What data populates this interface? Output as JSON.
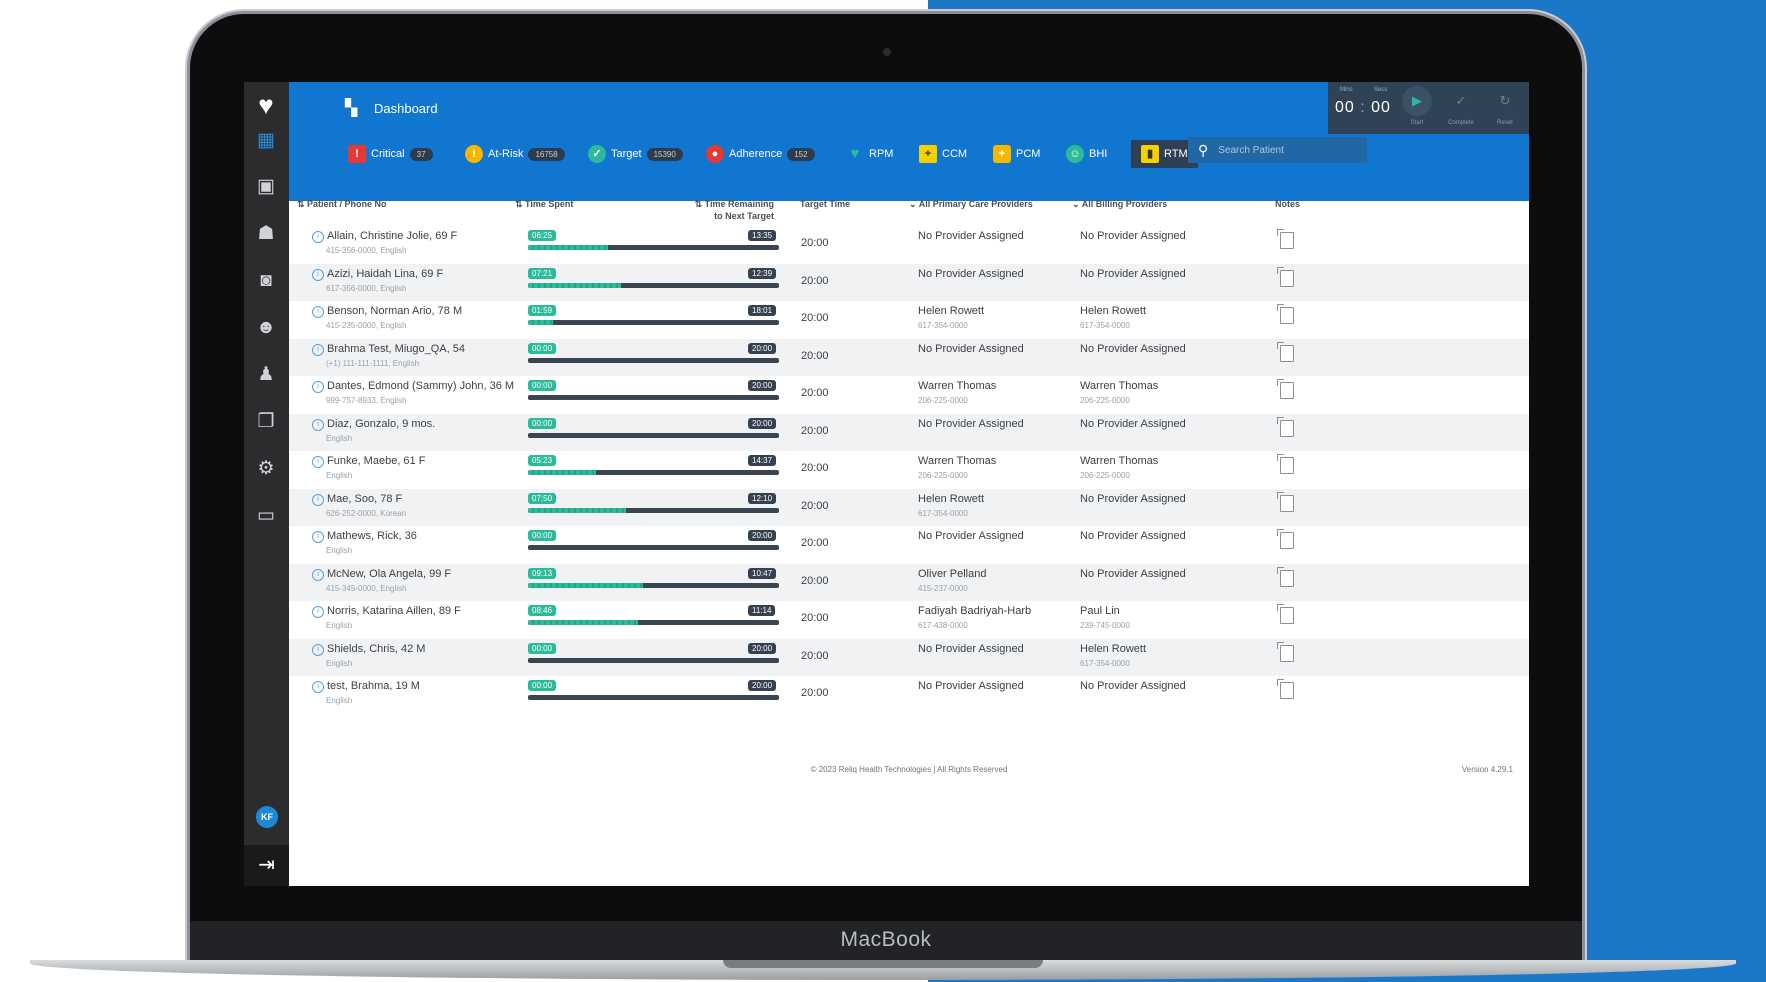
{
  "device": {
    "brand_label": "MacBook"
  },
  "app": {
    "title": "Dashboard",
    "search_placeholder": "Search Patient",
    "footer_text": "© 2023 Reliq Health Technologies | All Rights Reserved",
    "version": "Version 4.29.1"
  },
  "timer": {
    "mins_label": "Mins",
    "secs_label": "Secs",
    "minutes": "00",
    "separator": ":",
    "seconds": "00",
    "start_label": "Start",
    "complete_label": "Complete",
    "reset_label": "Reset"
  },
  "filters": [
    {
      "label": "Critical",
      "count": "37",
      "icon": "warning-triangle-icon",
      "color": "#e53935"
    },
    {
      "label": "At-Risk",
      "count": "16758",
      "icon": "exclamation-icon",
      "color": "#f5b800"
    },
    {
      "label": "Target",
      "count": "15390",
      "icon": "check-circle-icon",
      "color": "#2bbb9a"
    },
    {
      "label": "Adherence",
      "count": "152",
      "icon": "adherence-icon",
      "color": "#e53935"
    },
    {
      "label": "RPM",
      "icon": "heart-icon",
      "color": "#2bbb9a"
    },
    {
      "label": "CCM",
      "icon": "clipboard-plus-icon",
      "color": "#f5d100"
    },
    {
      "label": "PCM",
      "icon": "briefcase-icon",
      "color": "#f5b800"
    },
    {
      "label": "BHI",
      "icon": "head-icon",
      "color": "#2bbb9a"
    },
    {
      "label": "RTM",
      "icon": "rtm-icon",
      "color": "#f5d100"
    }
  ],
  "table": {
    "headers": {
      "patient": "Patient / Phone No",
      "time_spent": "Time Spent",
      "time_remaining_1": "Time Remaining",
      "time_remaining_2": "to Next Target",
      "target_time": "Target Time",
      "pcp": "All Primary Care Providers",
      "billing": "All Billing Providers",
      "notes": "Notes"
    },
    "rows": [
      {
        "name": "Allain, Christine Jolie, 69 F",
        "sub": "415-356-0000, English",
        "spent": "06:25",
        "remaining": "13:35",
        "progress": 0.32,
        "target": "20:00",
        "pcp": "No Provider Assigned",
        "pcp_phone": "",
        "billing": "No Provider Assigned",
        "billing_phone": ""
      },
      {
        "name": "Azizi, Haidah Lina, 69 F",
        "sub": "617-356-0000, English",
        "spent": "07:21",
        "remaining": "12:39",
        "progress": 0.37,
        "target": "20:00",
        "pcp": "No Provider Assigned",
        "pcp_phone": "",
        "billing": "No Provider Assigned",
        "billing_phone": ""
      },
      {
        "name": "Benson, Norman Ario, 78 M",
        "sub": "415-235-0000, English",
        "spent": "01:59",
        "remaining": "18:01",
        "progress": 0.1,
        "target": "20:00",
        "pcp": "Helen Rowett",
        "pcp_phone": "617-354-0000",
        "billing": "Helen Rowett",
        "billing_phone": "617-354-0000"
      },
      {
        "name": "Brahma Test, Miugo_QA, 54",
        "sub": "(+1) 111-111-1111, English",
        "spent": "00:00",
        "remaining": "20:00",
        "progress": 0,
        "target": "20:00",
        "pcp": "No Provider Assigned",
        "pcp_phone": "",
        "billing": "No Provider Assigned",
        "billing_phone": ""
      },
      {
        "name": "Dantes, Edmond (Sammy) John, 36 M",
        "sub": "999-757-8933, English",
        "spent": "00:00",
        "remaining": "20:00",
        "progress": 0,
        "target": "20:00",
        "pcp": "Warren Thomas",
        "pcp_phone": "206-225-0000",
        "billing": "Warren Thomas",
        "billing_phone": "206-225-0000"
      },
      {
        "name": "Diaz, Gonzalo, 9 mos.",
        "sub": "English",
        "spent": "00:00",
        "remaining": "20:00",
        "progress": 0,
        "target": "20:00",
        "pcp": "No Provider Assigned",
        "pcp_phone": "",
        "billing": "No Provider Assigned",
        "billing_phone": ""
      },
      {
        "name": "Funke, Maebe, 61 F",
        "sub": "English",
        "spent": "05:23",
        "remaining": "14:37",
        "progress": 0.27,
        "target": "20:00",
        "pcp": "Warren Thomas",
        "pcp_phone": "206-225-0000",
        "billing": "Warren Thomas",
        "billing_phone": "206-225-0000"
      },
      {
        "name": "Mae, Soo, 78 F",
        "sub": "626-252-0000, Korean",
        "spent": "07:50",
        "remaining": "12:10",
        "progress": 0.39,
        "target": "20:00",
        "pcp": "Helen Rowett",
        "pcp_phone": "617-354-0000",
        "billing": "No Provider Assigned",
        "billing_phone": ""
      },
      {
        "name": "Mathews, Rick, 36",
        "sub": "English",
        "spent": "00:00",
        "remaining": "20:00",
        "progress": 0,
        "target": "20:00",
        "pcp": "No Provider Assigned",
        "pcp_phone": "",
        "billing": "No Provider Assigned",
        "billing_phone": ""
      },
      {
        "name": "McNew, Ola Angela, 99 F",
        "sub": "415-345-0000, English",
        "spent": "09:13",
        "remaining": "10:47",
        "progress": 0.46,
        "target": "20:00",
        "pcp": "Oliver Pelland",
        "pcp_phone": "415-237-0000",
        "billing": "No Provider Assigned",
        "billing_phone": ""
      },
      {
        "name": "Norris, Katarina Aillen, 89 F",
        "sub": "English",
        "spent": "08:46",
        "remaining": "11:14",
        "progress": 0.44,
        "target": "20:00",
        "pcp": "Fadiyah Badriyah-Harb",
        "pcp_phone": "617-438-0000",
        "billing": "Paul Lin",
        "billing_phone": "239-745-0000"
      },
      {
        "name": "Shields, Chris, 42 M",
        "sub": "English",
        "spent": "00:00",
        "remaining": "20:00",
        "progress": 0,
        "target": "20:00",
        "pcp": "No Provider Assigned",
        "pcp_phone": "",
        "billing": "Helen Rowett",
        "billing_phone": "617-354-0000"
      },
      {
        "name": "test, Brahma, 19 M",
        "sub": "English",
        "spent": "00:00",
        "remaining": "20:00",
        "progress": 0,
        "target": "20:00",
        "pcp": "No Provider Assigned",
        "pcp_phone": "",
        "billing": "No Provider Assigned",
        "billing_phone": ""
      }
    ]
  },
  "sidebar": {
    "avatar_initials": "KF",
    "icons": [
      "dashboard-icon",
      "patient-card-icon",
      "care-team-icon",
      "devices-icon",
      "groups-icon",
      "user-profile-icon",
      "reports-icon",
      "user-settings-icon",
      "monitor-icon"
    ]
  },
  "colors": {
    "topbar": "#1176cf",
    "sidebar": "#2c2c2e",
    "spent_badge": "#2bbb9a",
    "remaining_badge": "#35414e",
    "background_right": "#1b78c8"
  }
}
